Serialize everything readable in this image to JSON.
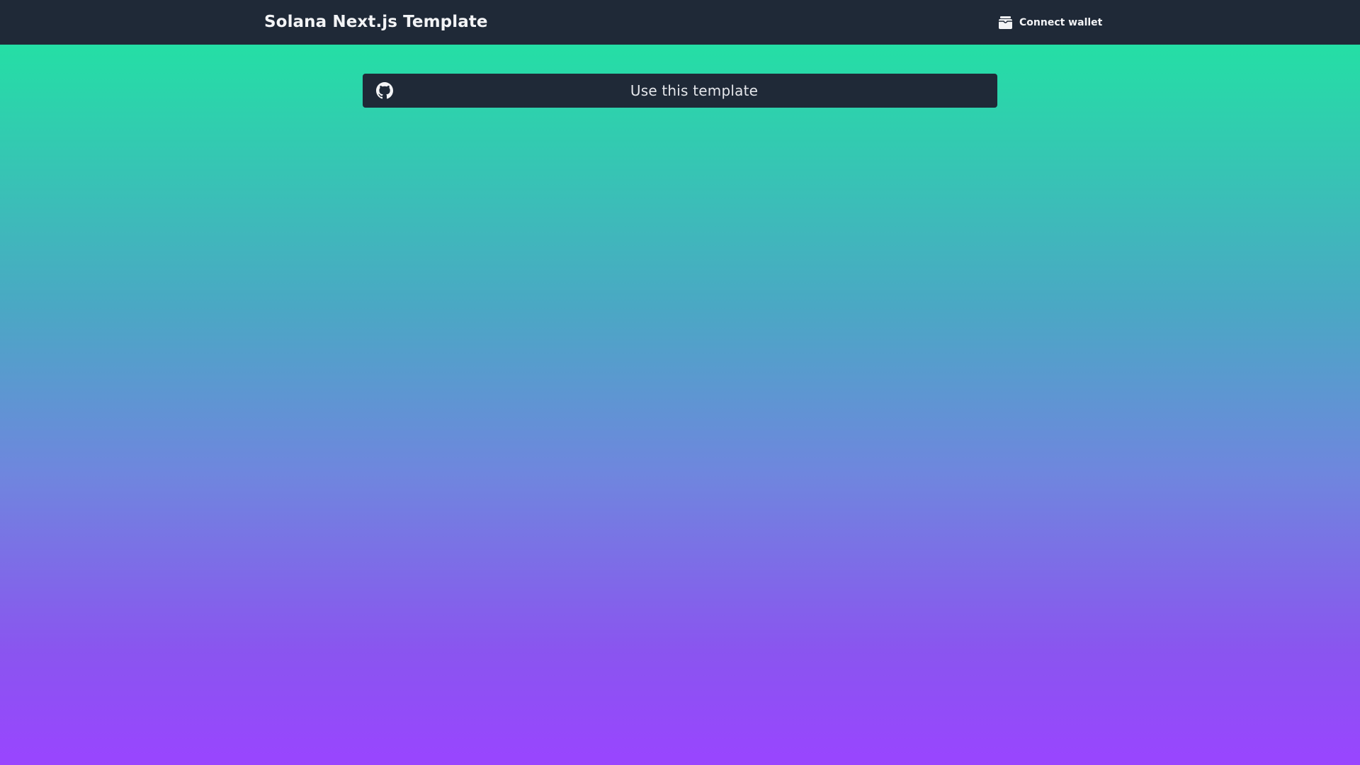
{
  "header": {
    "title": "Solana Next.js Template",
    "connect_wallet_label": "Connect wallet",
    "wallet_icon": "wallet-icon"
  },
  "main": {
    "template_button_label": "Use this template",
    "template_button_icon": "github-icon"
  },
  "colors": {
    "topbar_bg": "#1f2937",
    "gradient_top": "#1ee8a0",
    "gradient_bottom": "#9945ff",
    "text_light": "#f3f4f6"
  }
}
